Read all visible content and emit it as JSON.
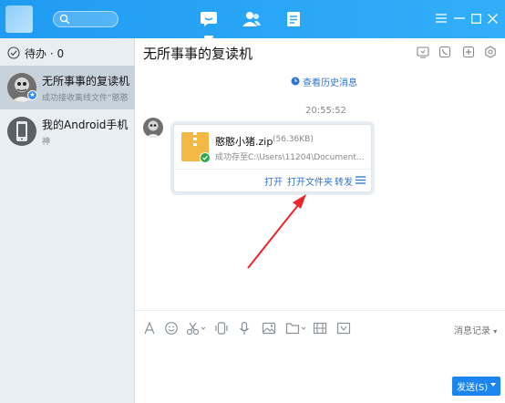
{
  "left_panel": {
    "todo_label": "待办 · 0",
    "contacts": [
      {
        "name": "无所事事的复读机",
        "preview": "成功接收离线文件“憨憨",
        "selected": true
      },
      {
        "name": "我的Android手机",
        "preview": "神",
        "selected": false
      }
    ]
  },
  "chat": {
    "title": "无所事事的复读机",
    "history_link": "查看历史消息",
    "timestamp": "20:55:52",
    "file": {
      "name": "憨憨小猪.zip",
      "size": "(56.36KB)",
      "status": "成功存至C:\\Users\\11204\\Document...",
      "actions": [
        "打开",
        "打开文件夹",
        "转发"
      ]
    }
  },
  "input": {
    "message_record": "消息记录",
    "send_label": "发送(S)"
  },
  "icons": [
    "search-icon",
    "chat-tab-icon",
    "contacts-tab-icon",
    "files-tab-icon",
    "menu-icon",
    "minimize-icon",
    "maximize-icon",
    "close-icon",
    "check-circle-icon",
    "screen-share-icon",
    "phone-icon",
    "add-member-icon",
    "settings-icon",
    "clock-icon",
    "font-icon",
    "emoji-icon",
    "scissors-icon",
    "shake-icon",
    "mic-icon",
    "image-icon",
    "folder-icon",
    "screenshot-icon",
    "calendar-icon"
  ],
  "colors": {
    "titlebar": "#2aa6f6",
    "accent": "#1c86ee",
    "link": "#2f74d0",
    "zip": "#f4b847"
  }
}
